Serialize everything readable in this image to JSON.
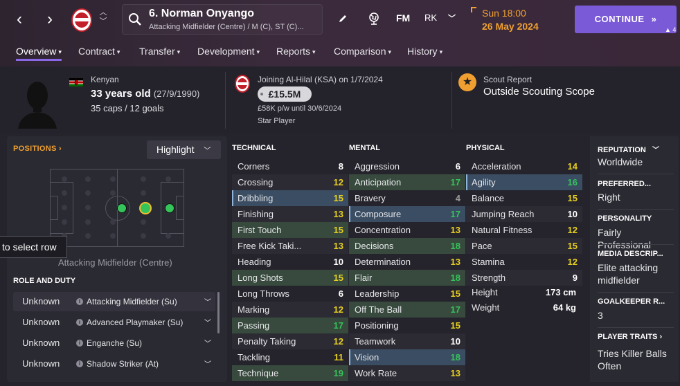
{
  "player": {
    "title": "6. Norman Onyango",
    "positions": "Attacking Midfielder (Centre) / M (C), ST (C)...",
    "nationality": "Kenyan",
    "age": "33 years old",
    "dob": "(27/9/1990)",
    "caps": "35 caps / 12 goals"
  },
  "toolbar": {
    "fm_label": "FM",
    "rk_label": "RK"
  },
  "date": {
    "time": "Sun 18:00",
    "date": "26 May 2024"
  },
  "continue": {
    "label": "CONTINUE",
    "badge": "4"
  },
  "tabs": [
    {
      "label": "Overview"
    },
    {
      "label": "Contract"
    },
    {
      "label": "Transfer"
    },
    {
      "label": "Development"
    },
    {
      "label": "Reports"
    },
    {
      "label": "Comparison"
    },
    {
      "label": "History"
    }
  ],
  "transfer": {
    "joining": "Joining Al-Hilal (KSA) on 1/7/2024",
    "value": "£15.5M",
    "wage": "£58K p/w until 30/6/2024",
    "status": "Star Player"
  },
  "scout": {
    "label": "Scout Report",
    "value": "Outside Scouting Scope"
  },
  "positions_panel": {
    "title": "POSITIONS",
    "highlight": "Highlight",
    "tooltip": "to select row",
    "position_label": "Attacking Midfielder (Centre)"
  },
  "role_duty": {
    "title": "ROLE AND DUTY",
    "rows": [
      {
        "duty": "Unknown",
        "role": "Attacking Midfielder (Su)"
      },
      {
        "duty": "Unknown",
        "role": "Advanced Playmaker (Su)"
      },
      {
        "duty": "Unknown",
        "role": "Enganche (Su)"
      },
      {
        "duty": "Unknown",
        "role": "Shadow Striker (At)"
      }
    ]
  },
  "attributes": {
    "technical": {
      "title": "TECHNICAL",
      "items": [
        {
          "name": "Corners",
          "value": "8"
        },
        {
          "name": "Crossing",
          "value": "12"
        },
        {
          "name": "Dribbling",
          "value": "15"
        },
        {
          "name": "Finishing",
          "value": "13"
        },
        {
          "name": "First Touch",
          "value": "15"
        },
        {
          "name": "Free Kick Taki...",
          "value": "13"
        },
        {
          "name": "Heading",
          "value": "10"
        },
        {
          "name": "Long Shots",
          "value": "15"
        },
        {
          "name": "Long Throws",
          "value": "6"
        },
        {
          "name": "Marking",
          "value": "12"
        },
        {
          "name": "Passing",
          "value": "17"
        },
        {
          "name": "Penalty Taking",
          "value": "12"
        },
        {
          "name": "Tackling",
          "value": "11"
        },
        {
          "name": "Technique",
          "value": "19"
        }
      ]
    },
    "mental": {
      "title": "MENTAL",
      "items": [
        {
          "name": "Aggression",
          "value": "6"
        },
        {
          "name": "Anticipation",
          "value": "17"
        },
        {
          "name": "Bravery",
          "value": "4"
        },
        {
          "name": "Composure",
          "value": "17"
        },
        {
          "name": "Concentration",
          "value": "13"
        },
        {
          "name": "Decisions",
          "value": "18"
        },
        {
          "name": "Determination",
          "value": "13"
        },
        {
          "name": "Flair",
          "value": "18"
        },
        {
          "name": "Leadership",
          "value": "15"
        },
        {
          "name": "Off The Ball",
          "value": "17"
        },
        {
          "name": "Positioning",
          "value": "15"
        },
        {
          "name": "Teamwork",
          "value": "10"
        },
        {
          "name": "Vision",
          "value": "18"
        },
        {
          "name": "Work Rate",
          "value": "13"
        }
      ]
    },
    "physical": {
      "title": "PHYSICAL",
      "items": [
        {
          "name": "Acceleration",
          "value": "14"
        },
        {
          "name": "Agility",
          "value": "16"
        },
        {
          "name": "Balance",
          "value": "15"
        },
        {
          "name": "Jumping Reach",
          "value": "10"
        },
        {
          "name": "Natural Fitness",
          "value": "12"
        },
        {
          "name": "Pace",
          "value": "15"
        },
        {
          "name": "Stamina",
          "value": "12"
        },
        {
          "name": "Strength",
          "value": "9"
        }
      ],
      "height_label": "Height",
      "height": "173 cm",
      "weight_label": "Weight",
      "weight": "64 kg"
    }
  },
  "side": {
    "reputation_h": "REPUTATION",
    "reputation": "Worldwide",
    "foot_h": "PREFERRED...",
    "foot": "Right",
    "personality_h": "PERSONALITY",
    "personality": "Fairly Professional",
    "media_h": "MEDIA DESCRIP...",
    "media": "Elite attacking midfielder",
    "gk_h": "GOALKEEPER R...",
    "gk": "3",
    "traits_h": "PLAYER TRAITS",
    "traits": "Tries Killer Balls Often"
  },
  "colors": {
    "accent": "#7b5ad8",
    "orange": "#f0a030",
    "green": "#35c45a",
    "yellow": "#e8d020",
    "white": "#ffffff",
    "grey": "#9a9a9a"
  }
}
